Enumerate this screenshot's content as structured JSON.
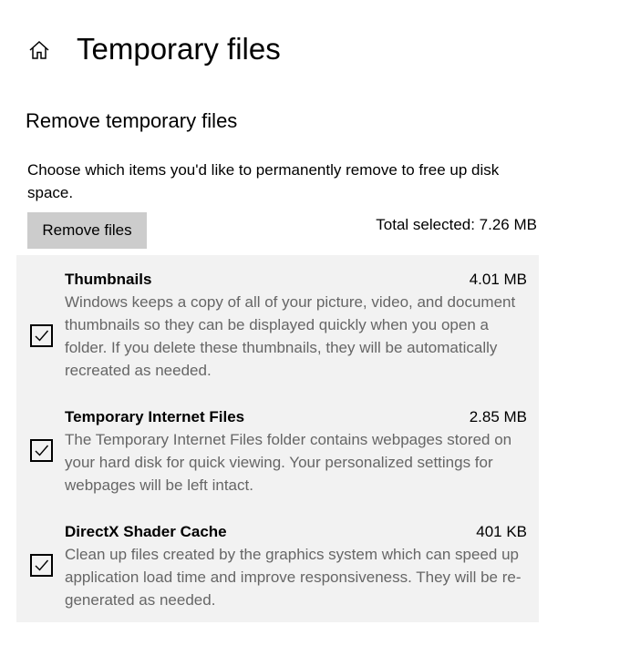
{
  "header": {
    "home_icon": "home-icon",
    "title": "Temporary files"
  },
  "section": {
    "title": "Remove temporary files",
    "description": "Choose which items you'd like to permanently remove to free up disk space.",
    "remove_button_label": "Remove files",
    "total_selected": "Total selected: 7.26 MB"
  },
  "items": [
    {
      "name": "Thumbnails",
      "size": "4.01 MB",
      "checked": true,
      "description": "Windows keeps a copy of all of your picture, video, and document thumbnails so they can be displayed quickly when you open a folder. If you delete these thumbnails, they will be automatically recreated as needed."
    },
    {
      "name": "Temporary Internet Files",
      "size": "2.85 MB",
      "checked": true,
      "description": "The Temporary Internet Files folder contains webpages stored on your hard disk for quick viewing. Your personalized settings for webpages will be left intact."
    },
    {
      "name": "DirectX Shader Cache",
      "size": "401 KB",
      "checked": true,
      "description": "Clean up files created by the graphics system which can speed up application load time and improve responsiveness. They will be re-generated as needed."
    }
  ],
  "colors": {
    "panel_background": "#f2f2f2",
    "button_background": "#cccccc",
    "description_text": "#666666"
  }
}
